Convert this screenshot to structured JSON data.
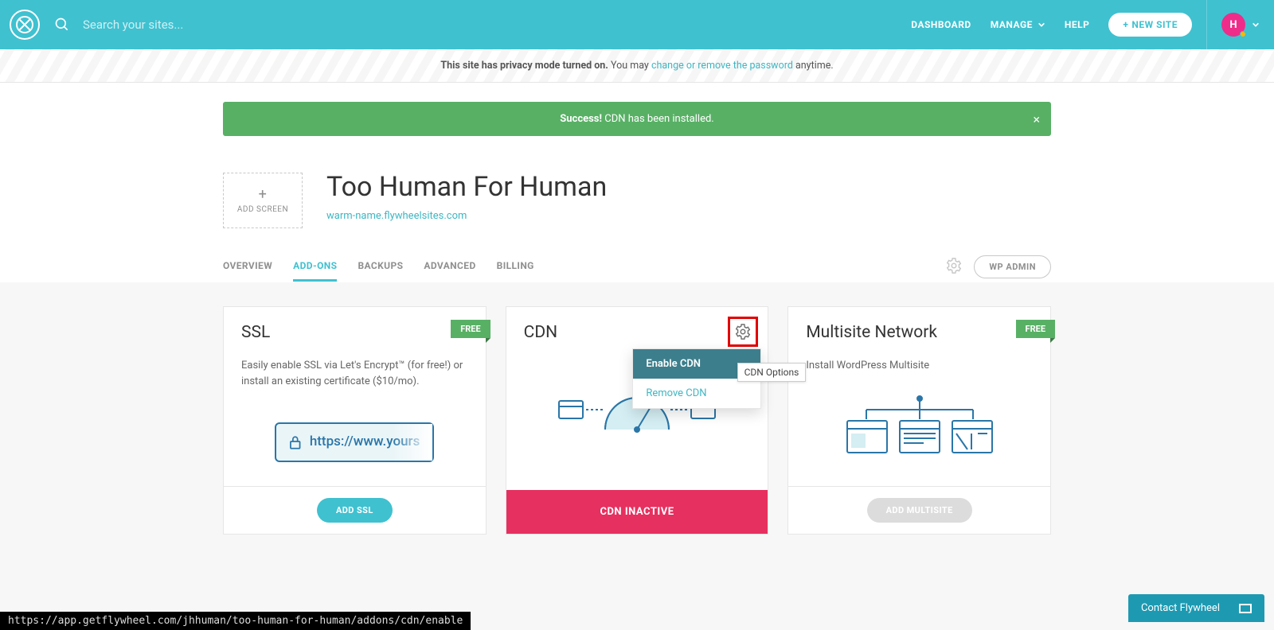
{
  "topbar": {
    "search_placeholder": "Search your sites...",
    "nav": {
      "dashboard": "DASHBOARD",
      "manage": "MANAGE",
      "help": "HELP",
      "new_site": "NEW SITE"
    },
    "avatar_initial": "H"
  },
  "privacy": {
    "lead": "This site has privacy mode turned on. ",
    "mid": "You may ",
    "link": "change or remove the password",
    "tail": " anytime."
  },
  "alert": {
    "strong": "Success!",
    "text": " CDN has been installed."
  },
  "site": {
    "add_screen": "ADD SCREEN",
    "title": "Too Human For Human",
    "url": "warm-name.flywheelsites.com"
  },
  "tabs": {
    "overview": "OVERVIEW",
    "addons": "ADD-ONS",
    "backups": "BACKUPS",
    "advanced": "ADVANCED",
    "billing": "BILLING",
    "wp_admin": "WP ADMIN"
  },
  "cards": {
    "ssl": {
      "title": "SSL",
      "badge": "FREE",
      "desc": "Easily enable SSL via Let's Encrypt™ (for free!) or install an existing certificate ($10/mo).",
      "url_sample": "https://www.yours",
      "cta": "ADD SSL"
    },
    "cdn": {
      "title": "CDN",
      "dropdown": {
        "enable": "Enable CDN",
        "remove": "Remove CDN"
      },
      "tooltip": "CDN Options",
      "status": "CDN INACTIVE"
    },
    "multisite": {
      "title": "Multisite Network",
      "badge": "FREE",
      "desc": "Install WordPress Multisite",
      "cta": "ADD MULTISITE"
    }
  },
  "status_url": "https://app.getflywheel.com/jhhuman/too-human-for-human/addons/cdn/enable",
  "contact": "Contact Flywheel"
}
